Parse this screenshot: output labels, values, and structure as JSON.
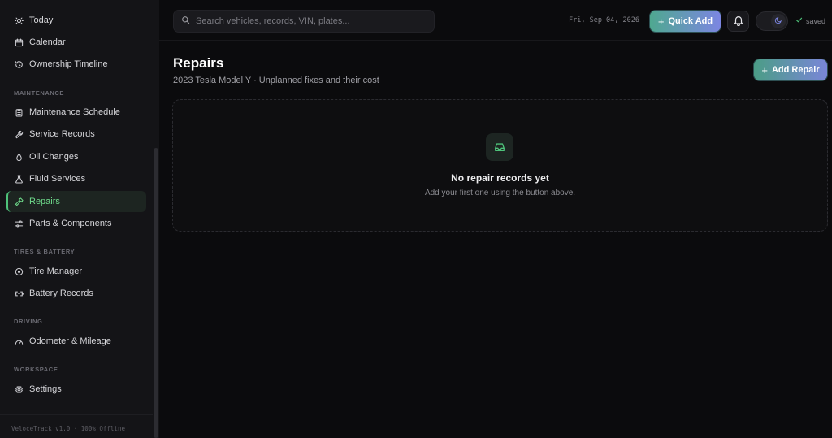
{
  "sidebar": {
    "top_items": [
      {
        "label": "Today",
        "icon": "sun-icon"
      },
      {
        "label": "Calendar",
        "icon": "calendar-icon"
      },
      {
        "label": "Ownership Timeline",
        "icon": "history-icon"
      }
    ],
    "sections": {
      "maintenance": "MAINTENANCE",
      "tires_battery": "TIRES & BATTERY",
      "driving": "DRIVING",
      "workspace": "WORKSPACE"
    },
    "maintenance_items": [
      {
        "label": "Maintenance Schedule",
        "icon": "clipboard-icon"
      },
      {
        "label": "Service Records",
        "icon": "wrench-icon"
      },
      {
        "label": "Oil Changes",
        "icon": "droplet-icon"
      },
      {
        "label": "Fluid Services",
        "icon": "flask-icon"
      },
      {
        "label": "Repairs",
        "icon": "hammer-icon",
        "active": true
      },
      {
        "label": "Parts & Components",
        "icon": "sliders-icon"
      }
    ],
    "tires_items": [
      {
        "label": "Tire Manager",
        "icon": "tire-icon"
      },
      {
        "label": "Battery Records",
        "icon": "battery-icon"
      }
    ],
    "driving_items": [
      {
        "label": "Odometer & Mileage",
        "icon": "gauge-icon"
      }
    ],
    "workspace_items": [
      {
        "label": "Settings",
        "icon": "gear-icon"
      }
    ],
    "footer": "VeloceTrack v1.0 · 100% Offline"
  },
  "topbar": {
    "search_placeholder": "Search vehicles, records, VIN, plates...",
    "date": "Fri, Sep 04, 2026",
    "quick_add_label": "Quick Add",
    "saved_label": "saved"
  },
  "main": {
    "title": "Repairs",
    "subtitle": "2023 Tesla Model Y · Unplanned fixes and their cost",
    "add_button_label": "Add Repair",
    "empty_title": "No repair records yet",
    "empty_subtitle": "Add your first one using the button above."
  },
  "colors": {
    "accent_green": "#6fdc8c",
    "accent_purple": "#7c86e2",
    "background": "#0b0b0d",
    "sidebar": "#141417"
  }
}
